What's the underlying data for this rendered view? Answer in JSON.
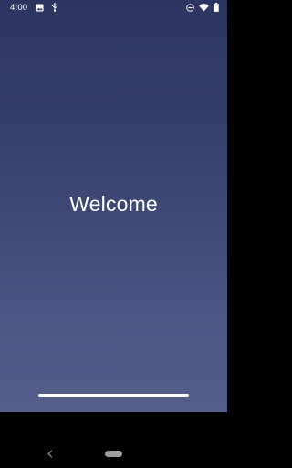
{
  "status_bar": {
    "time": "4:00",
    "left_icons": [
      "image-icon",
      "usb-debug-icon"
    ],
    "right_icons": [
      "do-not-disturb-icon",
      "wifi-icon",
      "battery-icon"
    ]
  },
  "main": {
    "welcome_text": "Welcome",
    "progress": 1.0
  },
  "nav_bar": {
    "back_icon": "back-chevron-icon",
    "home_icon": "home-pill-icon"
  },
  "colors": {
    "gradient_top": "#2b3560",
    "gradient_bottom": "#535e8b",
    "text": "#ffffff",
    "nav_background": "#000000",
    "home_pill": "#9e9e9e"
  }
}
